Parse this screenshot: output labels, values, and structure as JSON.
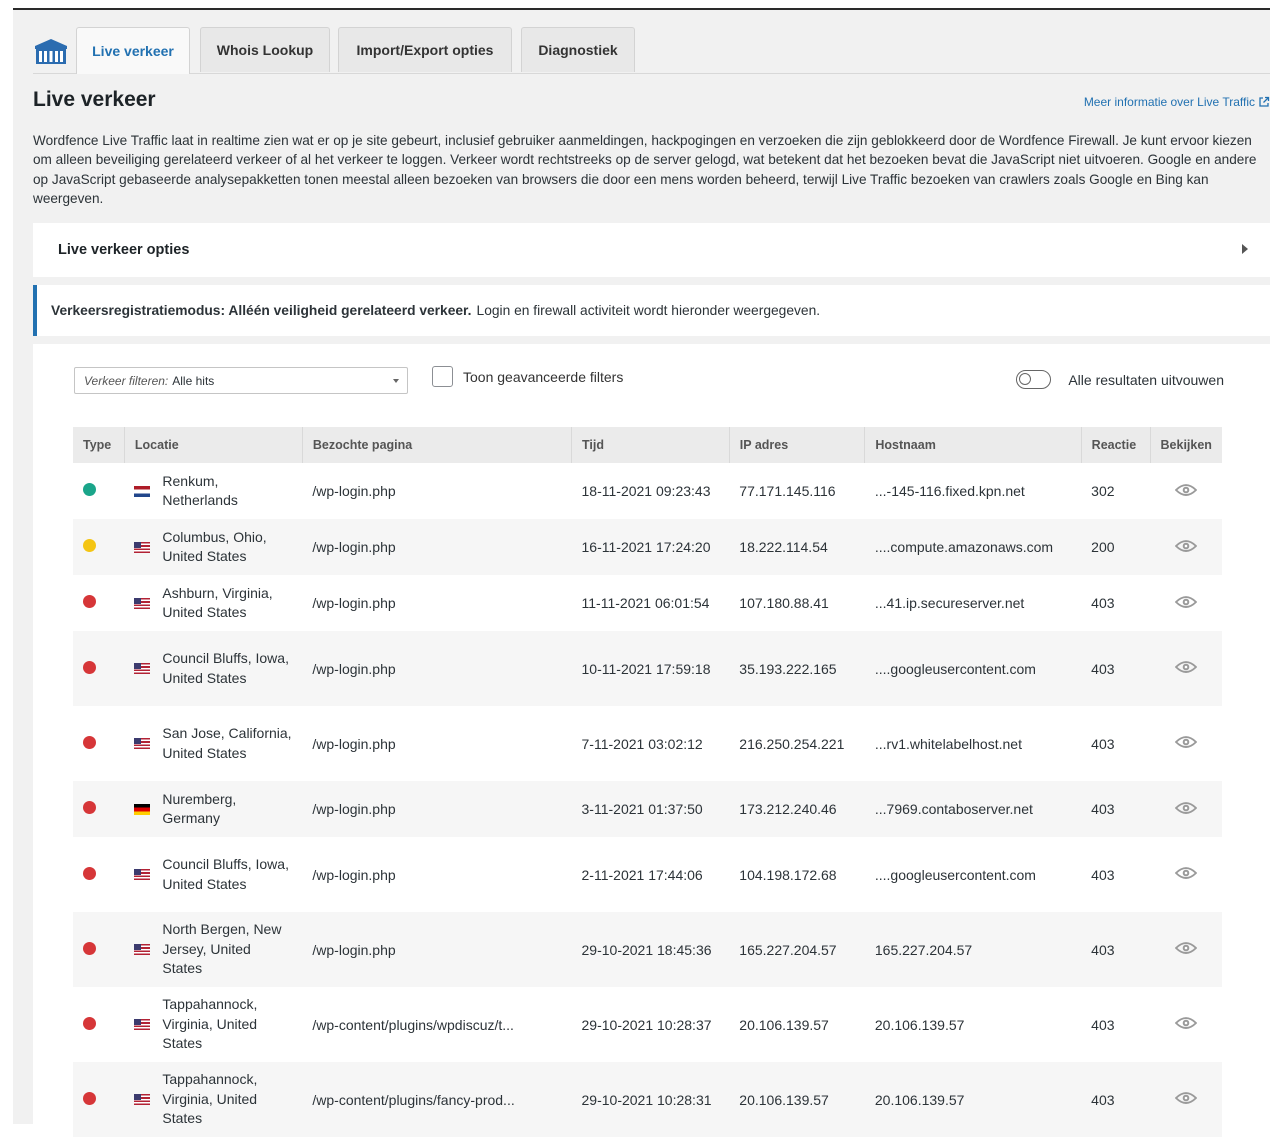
{
  "tabs": [
    "Live verkeer",
    "Whois Lookup",
    "Import/Export opties",
    "Diagnostiek"
  ],
  "page_title": "Live verkeer",
  "more_link": "Meer informatie over Live Traffic",
  "description": "Wordfence Live Traffic laat in realtime zien wat er op je site gebeurt, inclusief gebruiker aanmeldingen, hackpogingen en verzoeken die zijn geblokkeerd door de Wordfence Firewall. Je kunt ervoor kiezen om alleen beveiliging gerelateerd verkeer of al het verkeer te loggen. Verkeer wordt rechtstreeks op de server gelogd, wat betekent dat het bezoeken bevat die JavaScript niet uitvoeren. Google en andere op JavaScript gebaseerde analysepakketten tonen meestal alleen bezoeken van browsers die door een mens worden beheerd, terwijl Live Traffic bezoeken van crawlers zoals Google en Bing kan weergeven.",
  "options_label": "Live verkeer opties",
  "notice": {
    "bold": "Verkeersregistratiemodus: Alléén veiligheid gerelateerd verkeer.",
    "text": "Login en firewall activiteit wordt hieronder weergegeven."
  },
  "filter": {
    "prefix": "Verkeer filteren:",
    "value": "Alle hits"
  },
  "advanced_filters_label": "Toon geavanceerde filters",
  "expand_all_label": "Alle resultaten uitvouwen",
  "colors": {
    "accent": "#2271b1",
    "green": "#1aa58a",
    "yellow": "#f4c514",
    "red": "#d63638"
  },
  "columns": [
    "Type",
    "Locatie",
    "Bezochte pagina",
    "Tijd",
    "IP adres",
    "Hostnaam",
    "Reactie",
    "Bekijken"
  ],
  "rows": [
    {
      "type": "green",
      "flag": "nl",
      "location": "Renkum, Netherlands",
      "page": "/wp-login.php",
      "time": "18-11-2021 09:23:43",
      "ip": "77.171.145.116",
      "host": "...-145-116.fixed.kpn.net",
      "response": "302"
    },
    {
      "type": "yellow",
      "flag": "us",
      "location": "Columbus, Ohio, United States",
      "page": "/wp-login.php",
      "time": "16-11-2021 17:24:20",
      "ip": "18.222.114.54",
      "host": "....compute.amazonaws.com",
      "response": "200"
    },
    {
      "type": "red",
      "flag": "us",
      "location": "Ashburn, Virginia, United States",
      "page": "/wp-login.php",
      "time": "11-11-2021 06:01:54",
      "ip": "107.180.88.41",
      "host": "...41.ip.secureserver.net",
      "response": "403"
    },
    {
      "type": "red",
      "flag": "us",
      "location": "Council Bluffs, Iowa, United States",
      "page": "/wp-login.php",
      "time": "10-11-2021 17:59:18",
      "ip": "35.193.222.165",
      "host": "....googleusercontent.com",
      "response": "403"
    },
    {
      "type": "red",
      "flag": "us",
      "location": "San Jose, California, United States",
      "page": "/wp-login.php",
      "time": "7-11-2021 03:02:12",
      "ip": "216.250.254.221",
      "host": "...rv1.whitelabelhost.net",
      "response": "403"
    },
    {
      "type": "red",
      "flag": "de",
      "location": "Nuremberg, Germany",
      "page": "/wp-login.php",
      "time": "3-11-2021 01:37:50",
      "ip": "173.212.240.46",
      "host": "...7969.contaboserver.net",
      "response": "403"
    },
    {
      "type": "red",
      "flag": "us",
      "location": "Council Bluffs, Iowa, United States",
      "page": "/wp-login.php",
      "time": "2-11-2021 17:44:06",
      "ip": "104.198.172.68",
      "host": "....googleusercontent.com",
      "response": "403"
    },
    {
      "type": "red",
      "flag": "us",
      "location": "North Bergen, New Jersey, United States",
      "page": "/wp-login.php",
      "time": "29-10-2021 18:45:36",
      "ip": "165.227.204.57",
      "host": "165.227.204.57",
      "response": "403"
    },
    {
      "type": "red",
      "flag": "us",
      "location": "Tappahannock, Virginia, United States",
      "page": "/wp-content/plugins/wpdiscuz/t...",
      "time": "29-10-2021 10:28:37",
      "ip": "20.106.139.57",
      "host": "20.106.139.57",
      "response": "403"
    },
    {
      "type": "red",
      "flag": "us",
      "location": "Tappahannock, Virginia, United States",
      "page": "/wp-content/plugins/fancy-prod...",
      "time": "29-10-2021 10:28:31",
      "ip": "20.106.139.57",
      "host": "20.106.139.57",
      "response": "403"
    }
  ]
}
